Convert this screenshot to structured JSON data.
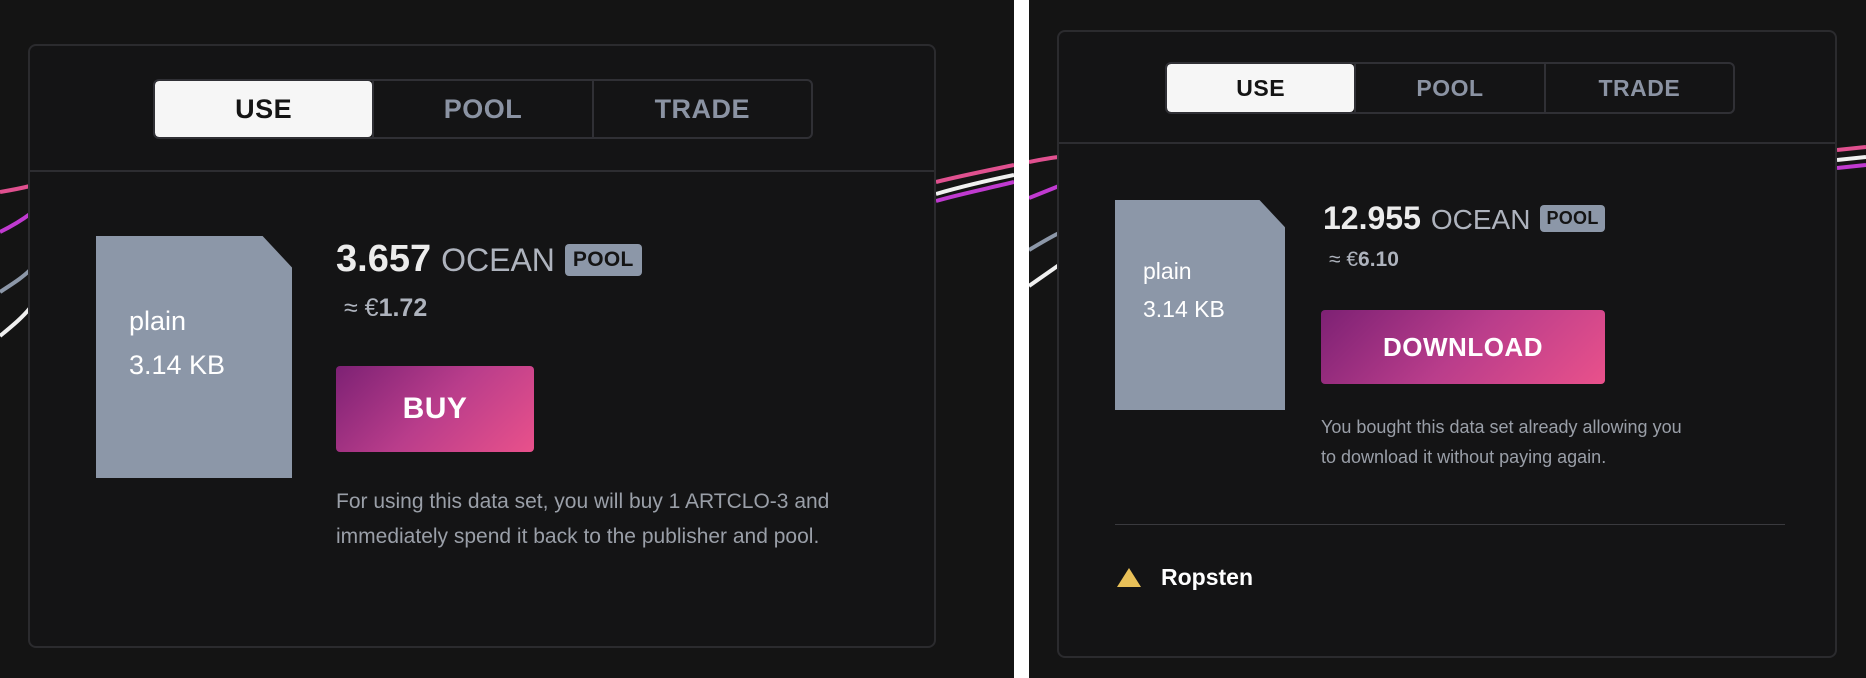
{
  "left_panel": {
    "tabs": [
      {
        "label": "USE",
        "active": true
      },
      {
        "label": "POOL",
        "active": false
      },
      {
        "label": "TRADE",
        "active": false
      }
    ],
    "file": {
      "type": "plain",
      "size": "3.14 KB"
    },
    "price": {
      "value": "3.657",
      "token": "OCEAN",
      "badge": "POOL"
    },
    "fiat": {
      "prefix": "≈ €",
      "amount": "1.72"
    },
    "action_label": "BUY",
    "help_text": "For using this data set, you will buy 1 ARTCLO-3 and immediately spend it back to the publisher and pool."
  },
  "right_panel": {
    "tabs": [
      {
        "label": "USE",
        "active": true
      },
      {
        "label": "POOL",
        "active": false
      },
      {
        "label": "TRADE",
        "active": false
      }
    ],
    "file": {
      "type": "plain",
      "size": "3.14 KB"
    },
    "price": {
      "value": "12.955",
      "token": "OCEAN",
      "badge": "POOL"
    },
    "fiat": {
      "prefix": "≈ €",
      "amount": "6.10"
    },
    "action_label": "DOWNLOAD",
    "help_text": "You bought this data set already allowing you to download it without paying again.",
    "network": {
      "icon": "warning-triangle-icon",
      "label": "Ropsten"
    }
  },
  "colors": {
    "background": "#141414",
    "file_icon": "#8c97a8",
    "button_gradient_start": "#7d2174",
    "button_gradient_end": "#e9518b",
    "warning": "#e8c058"
  }
}
